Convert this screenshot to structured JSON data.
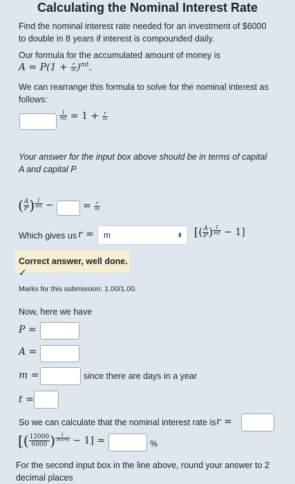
{
  "title": "Calculating the Nominal Interest Rate",
  "intro_line1": "Find the nominal interest rate needed for an investment of $6000",
  "intro_line2": "to double in 8 years if interest is compounded daily.",
  "formula_intro": "Our formula for the accumulated amount of money is",
  "formula": {
    "lhs": "A = P(1 +",
    "frac_num": "r",
    "frac_den": "m",
    "close": ")",
    "exp": "mt",
    "period": "."
  },
  "rearrange_line1": "We can rearrange this formula to solve for the nominal interest as",
  "rearrange_line2": "follows:",
  "eq1": {
    "exp_num": "1",
    "exp_den": "mt",
    "rhs": "= 1 +",
    "frac_num": "r",
    "frac_den": "m"
  },
  "hint_line1": "Your answer for the input box above should be in terms of capital",
  "hint_line2": "A and capital P",
  "eq2": {
    "A": "A",
    "P": "P",
    "exp_num": "1",
    "exp_den": "mt",
    "minus": "−",
    "equals": "=",
    "frac_num": "r",
    "frac_den": "m"
  },
  "which_gives": "Which gives us",
  "r_equals": "r =",
  "select_value": "m",
  "select_arrow": "⬍",
  "bracket_expr": {
    "open": "[(",
    "A": "A",
    "P": "P",
    "close": ")",
    "exp_num": "1",
    "exp_den": "mt",
    "tail": "− 1]"
  },
  "feedback": {
    "correct": "Correct answer, well done.",
    "check": "✓",
    "marks": "Marks for this submission: 1.00/1.00."
  },
  "now_here": "Now, here we have",
  "vars": {
    "P": "P =",
    "A": "A =",
    "m": "m =",
    "t": "t ="
  },
  "since_text": "since there are days in a year",
  "calc_line": "So we can calculate that the nominal interest rate is",
  "calc_r": "r =",
  "final_expr": {
    "open": "[(",
    "num": "12000",
    "den": "6000",
    "close": ")",
    "exp_num": "1",
    "exp_den": "365•8",
    "tail": "− 1] ≃"
  },
  "percent": "%",
  "round_line1": "For the second input box in the line above, round your answer to 2",
  "round_line2": "decimal places",
  "colors": {
    "background": "#dfe7ee",
    "feedback_bg": "#f5efd5",
    "input_border": "#9aa4ad"
  }
}
